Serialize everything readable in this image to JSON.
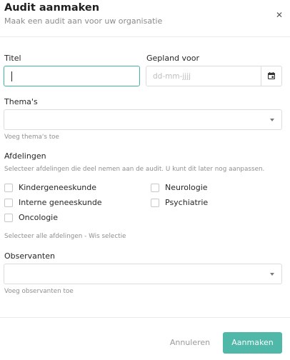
{
  "header": {
    "title": "Audit aanmaken",
    "subtitle": "Maak een audit aan voor uw organisatie",
    "close_icon": "close-icon"
  },
  "form": {
    "title_label": "Titel",
    "title_value": "",
    "planned_label": "Gepland voor",
    "planned_placeholder": "dd-mm-jjjj",
    "calendar_icon": "calendar-icon",
    "themes_label": "Thema's",
    "themes_help": "Voeg thema's toe",
    "departments_label": "Afdelingen",
    "departments_help": "Selecteer afdelingen die deel nemen aan de audit. U kunt dit later nog aanpassen.",
    "departments": [
      {
        "label": "Kindergeneeskunde",
        "checked": false
      },
      {
        "label": "Neurologie",
        "checked": false
      },
      {
        "label": "Interne geneeskunde",
        "checked": false
      },
      {
        "label": "Psychiatrie",
        "checked": false
      },
      {
        "label": "Oncologie",
        "checked": false
      }
    ],
    "select_all_help": "Selecteer alle afdelingen - Wis selectie",
    "observers_label": "Observanten",
    "observers_help": "Voeg observanten toe"
  },
  "footer": {
    "cancel_label": "Annuleren",
    "create_label": "Aanmaken"
  },
  "colors": {
    "accent": "#4fb8a9",
    "focus_border": "#43b3a3"
  }
}
